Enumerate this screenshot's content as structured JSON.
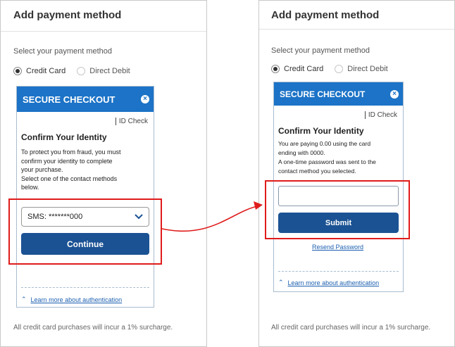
{
  "left": {
    "title": "Add payment method",
    "select_label": "Select your payment method",
    "radio_credit": "Credit Card",
    "radio_debit": "Direct Debit",
    "widget": {
      "header": "SECURE CHECKOUT",
      "close": "×",
      "id_check": "ID Check",
      "title": "Confirm Your Identity",
      "body_1": "To protect you from fraud, you must",
      "body_2": "confirm your identity to complete",
      "body_3": "your purchase.",
      "body_4": "Select one of the contact methods",
      "body_5": "below.",
      "select_value": "SMS: *******000",
      "button": "Continue",
      "learn_more": "Learn more about authentication"
    },
    "footer": "All credit card purchases will incur a 1% surcharge."
  },
  "right": {
    "title": "Add payment method",
    "select_label": "Select your payment method",
    "radio_credit": "Credit Card",
    "radio_debit": "Direct Debit",
    "widget": {
      "header": "SECURE CHECKOUT",
      "close": "×",
      "id_check": "ID Check",
      "title": "Confirm Your Identity",
      "body_1": "You are paying 0.00 using the card",
      "body_2": "ending with 0000.",
      "body_3": "A one-time password was sent to the",
      "body_4": "contact method you selected.",
      "otp_value": "",
      "button": "Submit",
      "resend": "Resend Password",
      "learn_more": "Learn more about authentication"
    },
    "footer": "All credit card purchases will incur a 1% surcharge."
  },
  "colors": {
    "header_blue": "#1c73c7",
    "button_blue": "#1b5294",
    "annotation_red": "#e01b1b",
    "link_blue": "#1c5fb0"
  }
}
